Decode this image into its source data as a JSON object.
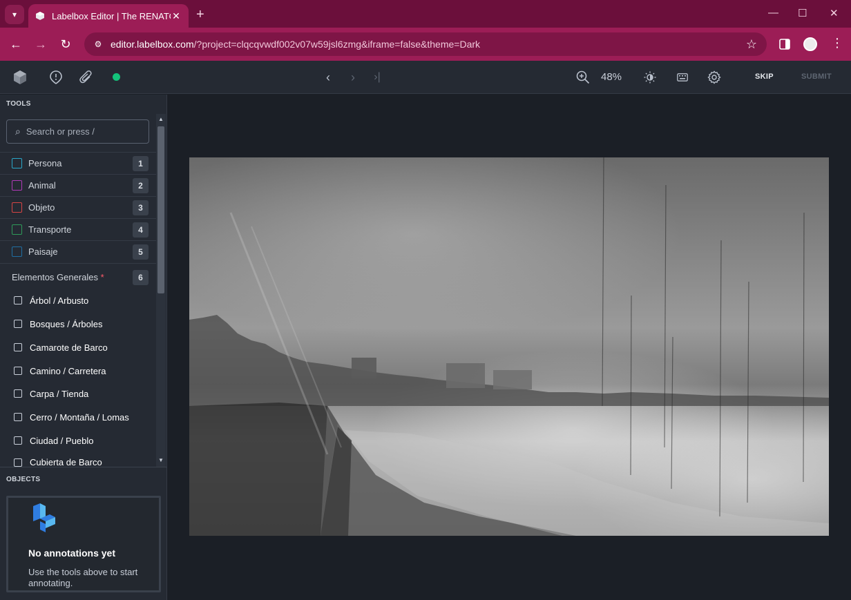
{
  "browser": {
    "tab_title": "Labelbox Editor | The RENATO P",
    "url_host": "editor.labelbox.com",
    "url_rest": "/?project=clqcqvwdf002v07w59jsl6zmg&iframe=false&theme=Dark"
  },
  "header": {
    "zoom": "48%",
    "skip_label": "SKIP",
    "submit_label": "SUBMIT"
  },
  "tools": {
    "section_title": "TOOLS",
    "search_placeholder": "Search or press /",
    "items": [
      {
        "label": "Persona",
        "key": "1",
        "color": "#2aa7c9"
      },
      {
        "label": "Animal",
        "key": "2",
        "color": "#b13ab8"
      },
      {
        "label": "Objeto",
        "key": "3",
        "color": "#d84545"
      },
      {
        "label": "Transporte",
        "key": "4",
        "color": "#2f9b5a"
      },
      {
        "label": "Paisaje",
        "key": "5",
        "color": "#1f6fa3"
      }
    ],
    "general": {
      "label": "Elementos Generales",
      "required": "*",
      "key": "6",
      "options": [
        "Árbol / Arbusto",
        "Bosques / Árboles",
        "Camarote de Barco",
        "Camino / Carretera",
        "Carpa / Tienda",
        "Cerro / Montaña / Lomas",
        "Ciudad / Pueblo",
        "Cubierta de Barco"
      ]
    }
  },
  "objects": {
    "section_title": "OBJECTS",
    "empty_title": "No annotations yet",
    "empty_desc": "Use the tools above to start annotating."
  }
}
